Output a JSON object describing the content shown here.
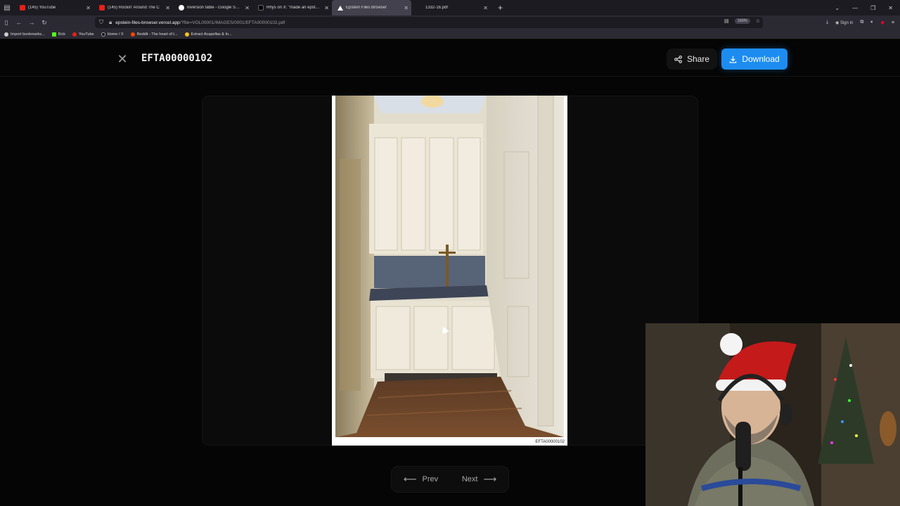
{
  "browser": {
    "tabs": [
      {
        "title": "(145) YouTube",
        "color": "#e62117",
        "active": false
      },
      {
        "title": "(145) Rockin' Around The C",
        "color": "#e62117",
        "active": false
      },
      {
        "title": "inversion table - Google Search",
        "color": "#ffffff",
        "active": false
      },
      {
        "title": "Rhys on X: \"made an epstein fil",
        "color": "#000000",
        "active": false
      },
      {
        "title": "Epstein Files Browser",
        "color": "#ffffff",
        "active": true
      },
      {
        "title": "1332-16.pdf",
        "color": "#888888",
        "active": false
      }
    ],
    "new_tab_icon": "+",
    "url_host": "epstein-files-browser.vercel.app",
    "url_path": "/?file=VOL00001/IMAGES/0001/EFTA00000102.pdf",
    "zoom": "160%",
    "sign_in": "Sign in",
    "bookmarks": [
      {
        "label": "Import bookmarks...",
        "color": "#cccccc"
      },
      {
        "label": "Kick",
        "color": "#53fc18"
      },
      {
        "label": "YouTube",
        "color": "#e62117"
      },
      {
        "label": "Home / X",
        "color": "#ffffff"
      },
      {
        "label": "Reddit - The heart of t...",
        "color": "#ff4500"
      },
      {
        "label": "Extract Acapellas & In...",
        "color": "#f5c518"
      }
    ]
  },
  "viewer": {
    "file_name": "EFTA00000102",
    "share_label": "Share",
    "download_label": "Download",
    "prev_label": "Prev",
    "next_label": "Next",
    "page_stamp": "EFTA00000102",
    "accent_color": "#1d8cf0"
  },
  "icons": {
    "close": "close-icon",
    "share": "share-icon",
    "download": "download-icon",
    "prev": "arrow-left-icon",
    "next": "arrow-right-icon"
  }
}
